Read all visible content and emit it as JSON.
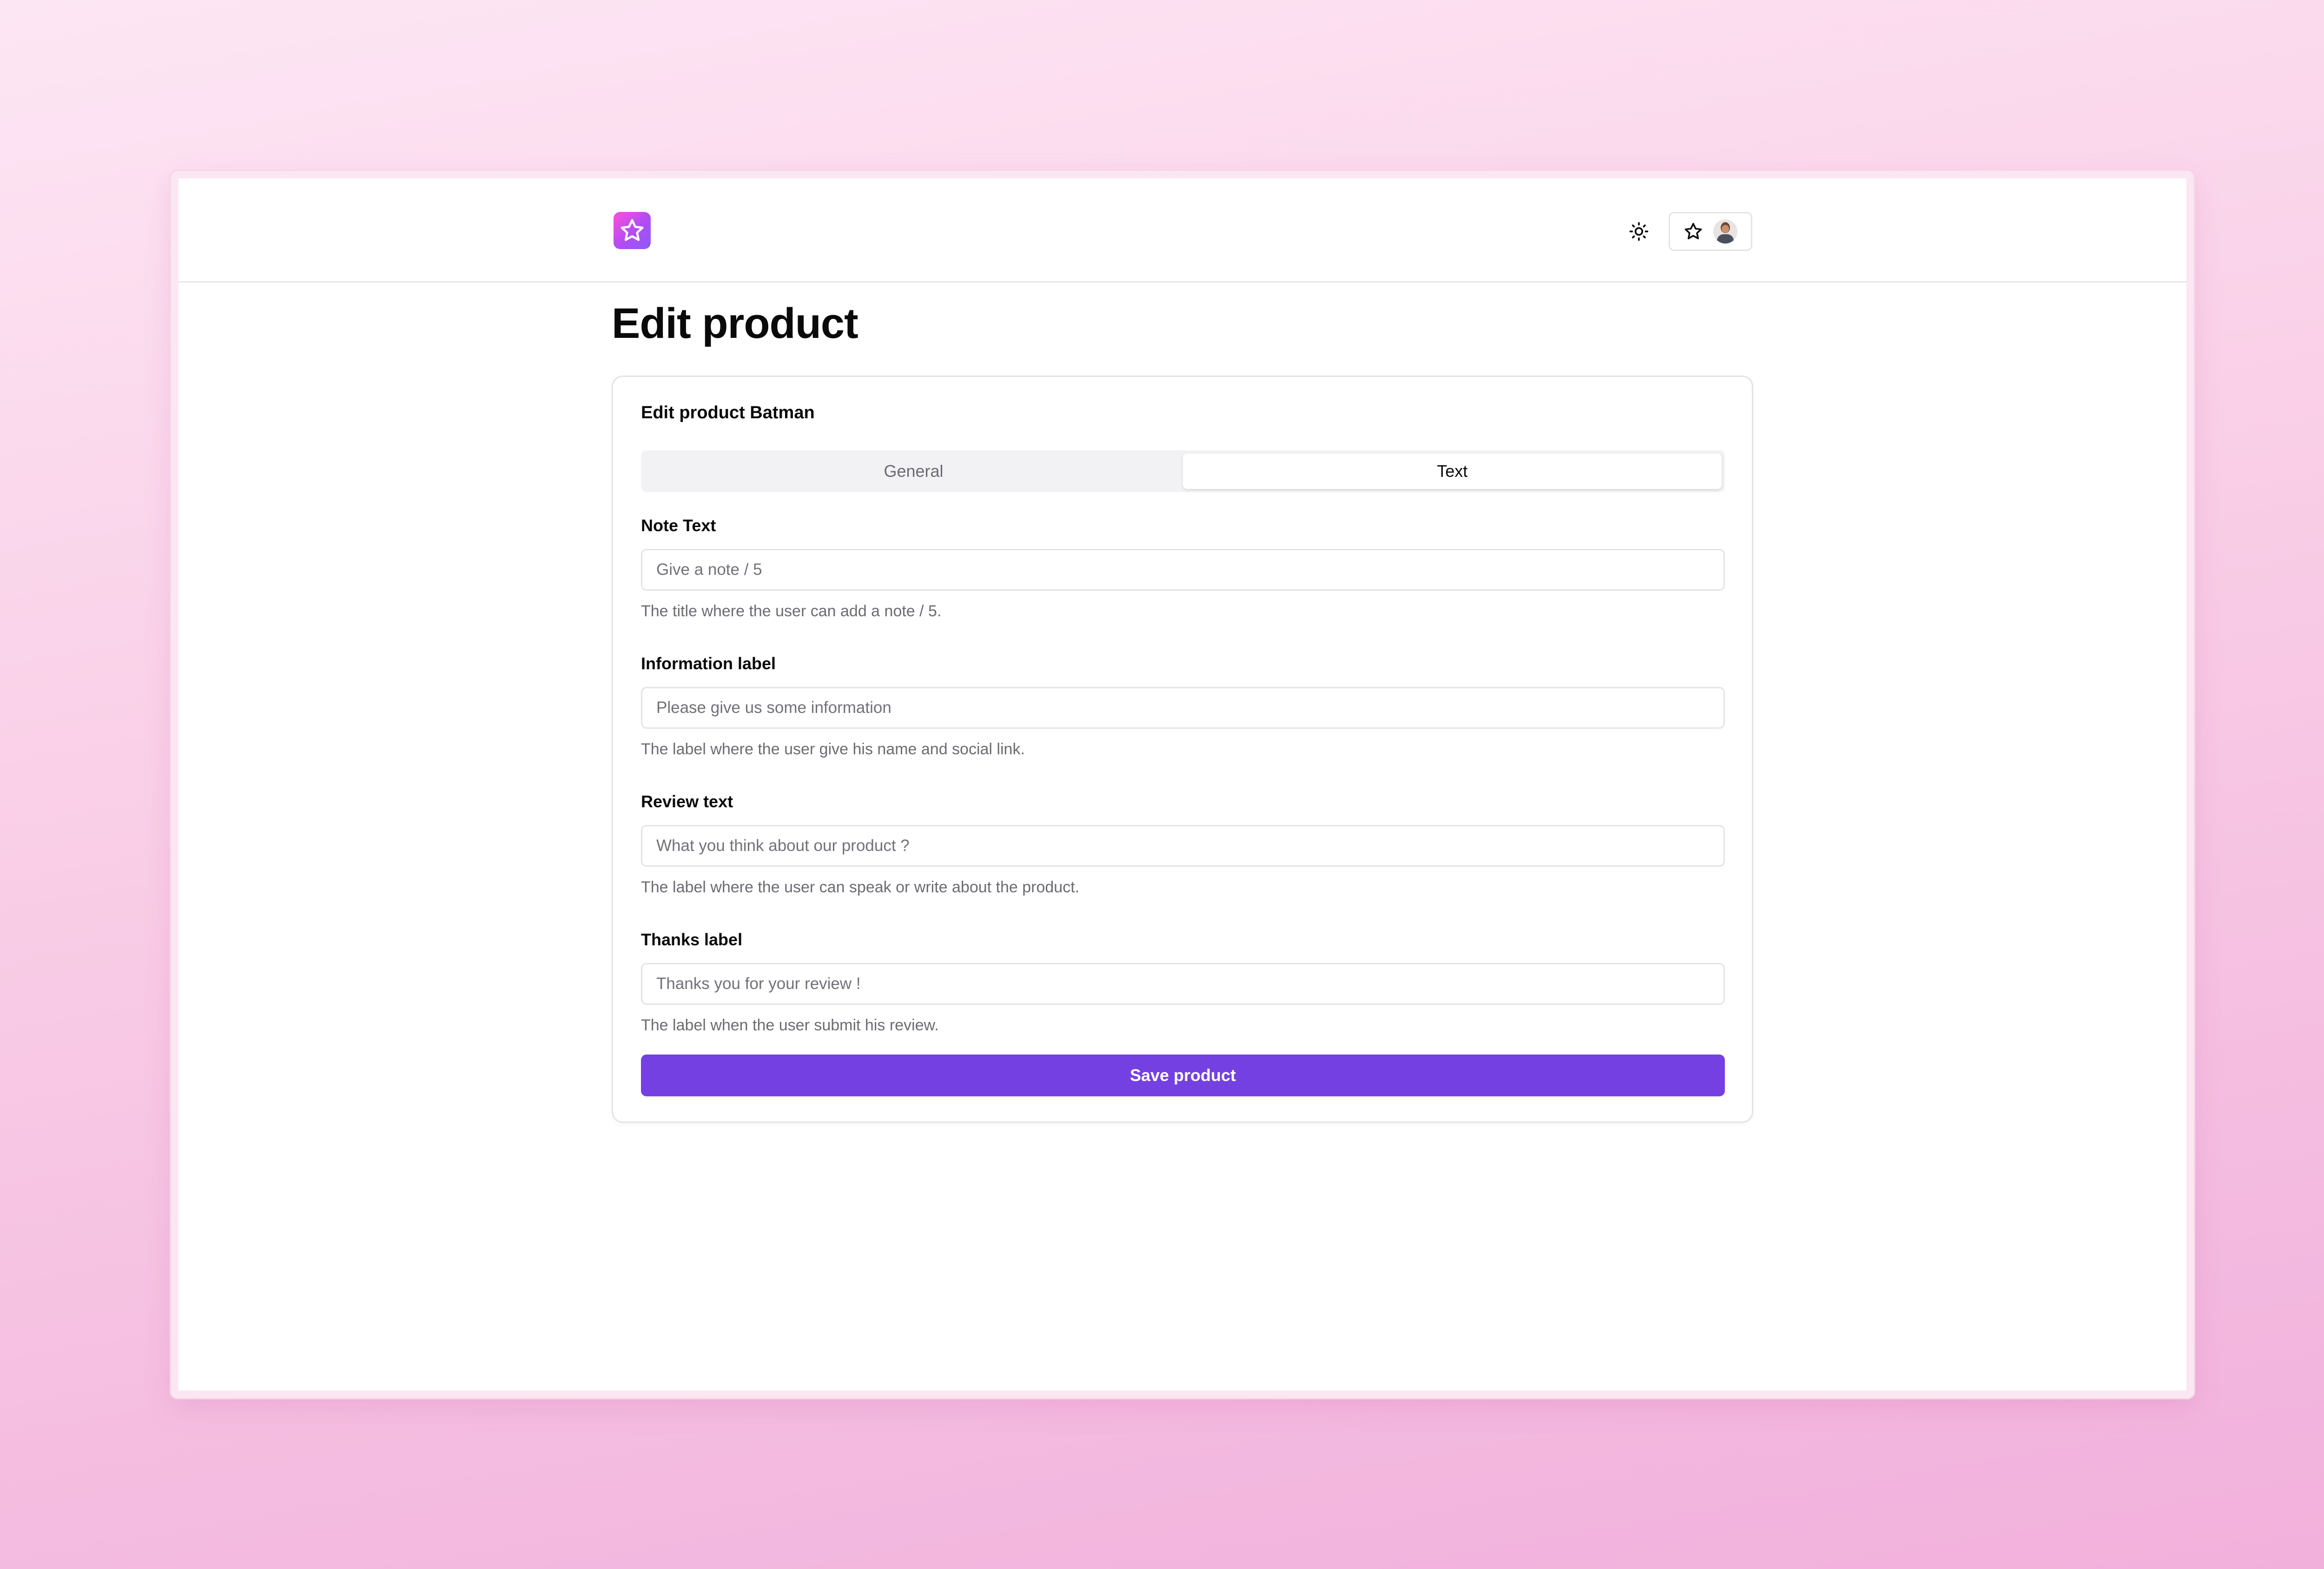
{
  "header": {
    "logo_icon": "star-icon",
    "theme_icon": "sun-icon",
    "user_menu": {
      "icon": "star-icon",
      "avatar": "avatar"
    }
  },
  "page": {
    "title": "Edit product"
  },
  "card": {
    "title": "Edit product Batman",
    "tabs": [
      {
        "label": "General",
        "active": false
      },
      {
        "label": "Text",
        "active": true
      }
    ],
    "fields": [
      {
        "label": "Note Text",
        "placeholder": "Give a note / 5",
        "value": "",
        "help": "The title where the user can add a note / 5."
      },
      {
        "label": "Information label",
        "placeholder": "Please give us some information",
        "value": "",
        "help": "The label where the user give his name and social link."
      },
      {
        "label": "Review text",
        "placeholder": "What you think about our product ?",
        "value": "",
        "help": "The label where the user can speak or write about the product."
      },
      {
        "label": "Thanks label",
        "placeholder": "Thanks you for your review !",
        "value": "",
        "help": "The label when the user submit his review."
      }
    ],
    "save_label": "Save product"
  },
  "colors": {
    "accent": "#7540e2",
    "logo_gradient_start": "#ff4fd8",
    "logo_gradient_end": "#8a5cf7",
    "background_top": "#fde6f4",
    "background_bottom": "#f1b0dc"
  }
}
